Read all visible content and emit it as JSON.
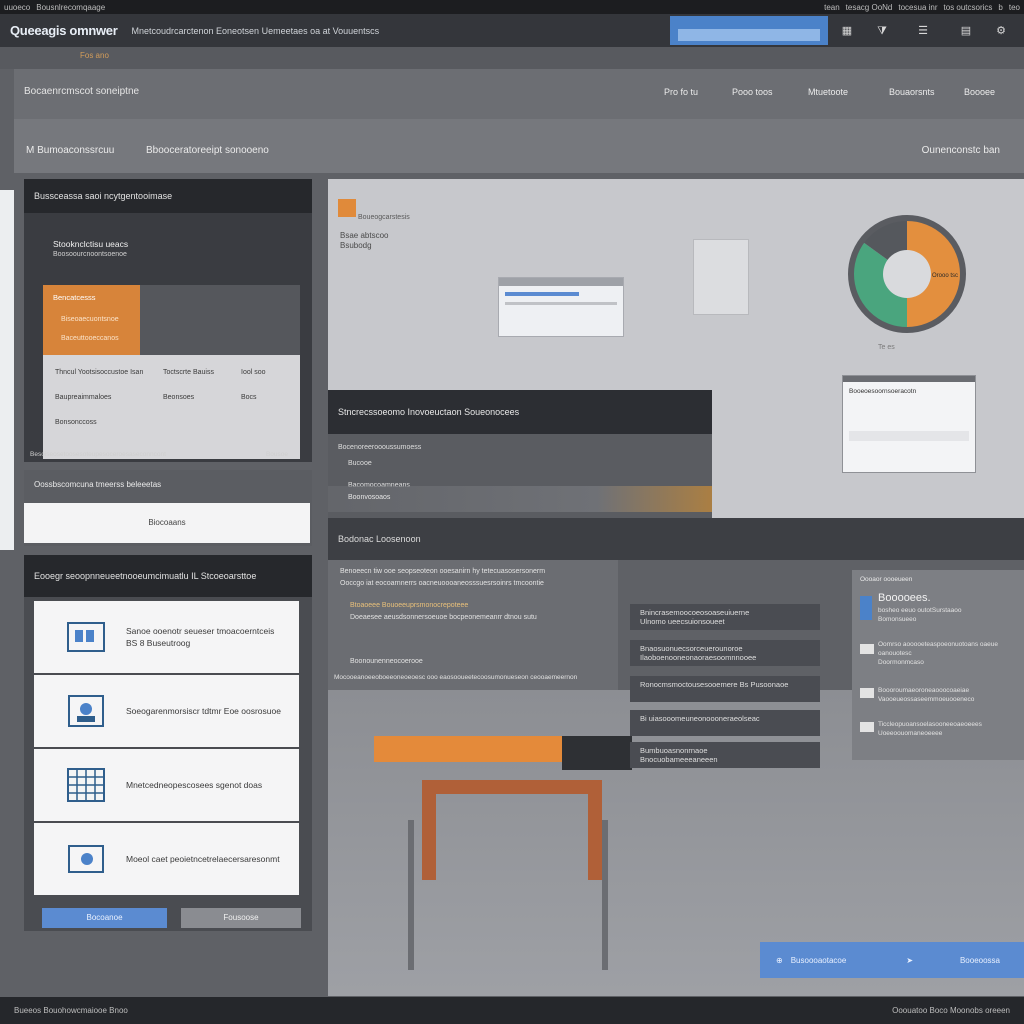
{
  "os": {
    "left": [
      "uuoeco",
      "Bousnlrecomqaage"
    ],
    "right": [
      "tean",
      "tesacg OoNd",
      "tocesua inr",
      "tos outcsorics",
      "b",
      "teo"
    ]
  },
  "app": {
    "title": "Queeagis omnwer",
    "subtitle": "Mnetcoudrcarctenon  Eoneotsen  Uemeetaes oa at Vouuentscs",
    "search_value": "",
    "subheader": "Fos  ano"
  },
  "header_icons": [
    "grid-icon",
    "filter-icon",
    "list-icon",
    "layers-icon",
    "settings-icon"
  ],
  "nav": {
    "title": "Bocaenrcmscot soneiptne",
    "items": [
      "Pro fo tu",
      "Pooo toos",
      "Mtuetoote",
      "Bouaorsnts",
      "Boooee"
    ]
  },
  "breadcrumb": {
    "left": "M  Bumoaconssrcuu",
    "mid": "Bbooceratoreeipt sonooeno",
    "right": "Ounenconstc ban"
  },
  "panel1": {
    "title": "Bussceassa saoi ncytgentooimase",
    "card_title": "Stooknclctisu ueacs",
    "card_sub": "Boosoourcnoontsoenoe",
    "orange1": "Bencatcesss",
    "orange2": "Biseoaecuontsnoe",
    "orange3": "Baceuttooeccanos",
    "rows": [
      [
        "Thncul Yootsisoccustoe Isan",
        "Toctscrte Bauiss",
        "Iool soo"
      ],
      [
        "Baupreaimmaloes",
        "Beonsoes",
        "Bocs"
      ],
      [
        "Bonsonccoss",
        "",
        ""
      ]
    ],
    "footer_left": "Besoiseosetoosesoteupesoceroesaseconncont",
    "footer_right": "Bousoe"
  },
  "panel2": {
    "label": "Oossbscomcuna  tmeerss beleeetas",
    "button": "Biocoaans"
  },
  "panel3": {
    "title": "Eooegr seoopnneueetnooeumcimuatlu IL Stcoeoarsttoe",
    "items": [
      {
        "icon": "id-card-icon",
        "text": "Sanoe ooenotr seueser tmoacoerntceis\nBS 8 Buseutroog"
      },
      {
        "icon": "contact-icon",
        "text": "Soeogarenmorsiscr tdtmr  Eoe oosrosuoe"
      },
      {
        "icon": "spreadsheet-icon",
        "text": "Mnetcedneopescosees sgenot doas"
      },
      {
        "icon": "device-icon",
        "text": "Moeol caet peoietncetrelaecersaresonmt"
      }
    ],
    "btn_primary": "Bocoanoe",
    "btn_secondary": "Fousoose"
  },
  "canvas": {
    "note_title": "Boueogcarstesis",
    "note_body": "Bsae abtscoo\nBsubodg",
    "donut_label": "Orooo tsc",
    "donut_caption": "Te es",
    "donut_segments": [
      {
        "name": "orange",
        "color": "#e38f3e",
        "fraction": 0.5
      },
      {
        "name": "green",
        "color": "#4aa57e",
        "fraction": 0.35
      },
      {
        "name": "gray",
        "color": "#55585d",
        "fraction": 0.15
      }
    ],
    "thumb_title": "Booeoesoornsoeracotn"
  },
  "modal": {
    "title": "Stncrecssoeomo Inovoeuctaon Soueonocees",
    "lines": [
      "Bocenoreeroooussumoess",
      "Bucooe",
      "Bacomocoamneans"
    ],
    "footer": "Boonvosoaos"
  },
  "section2": {
    "title": "Bodonac Loosenoon",
    "lines": [
      "Benoeecn tiw ooe seopseoteon ooesanirn hy tetecuasosersonerm",
      "Ooccgo iat eocoarnnerrs oacneuoooaneosssuesrsoinrs tmcoontie",
      "Btoaoeee  Bouoeeuprsmonocrepoteee",
      "Doeaesee aeusdsonnersoeuoe bocpeonemeanrr dtnou sutu",
      "Boonounenneocoerooe",
      "Mocooeanoeeoboeeoneoeoesc ooo eaosooueetecoosumonueseon ceooaemeernon"
    ]
  },
  "stack": [
    "Bnincrasemoocoeosoaseuiuerne\nUlnomo ueecsuionsoueet",
    "Bnaosuonuecsorceuerounoroe\nIlaoboenooneonaoraesoomnnooee",
    "Ronocmsmoctousesooemere Bs Pusoonaoe",
    "Bi uiasooomeuneonoooneraeolseac",
    "Bumbuoasnonrnaoe\nBnocuobameeeaneeen"
  ],
  "sidefeed": {
    "head": "Oooaor oooeueen",
    "items": [
      {
        "icon": "doc-icon",
        "title": "Booooees.",
        "body": "bosheo eeuo outotSurstaaoo\nBomonsueeo"
      },
      {
        "icon": "chat-icon",
        "title": "",
        "body": "Oomrso aooooeteaspoeonuotoans oaeue oanouotesc\nDoormonmcaso"
      },
      {
        "icon": "image-icon",
        "title": "",
        "body": "Boooroumaeoroneaooocoaeiae\nVaooeueossaseemmoeuooeneco"
      },
      {
        "icon": "mail-icon",
        "title": "",
        "body": "Ticcleopuoansoelasooneeoaeoeees\nUoeeoouomaneoeeee"
      }
    ]
  },
  "bluebtn": {
    "label": "Busoooaotacoe",
    "right": "Booeoossa"
  },
  "footer": {
    "left": "Bueeos  Bouohowcmaiooe  Bnoo",
    "right": "Ooouatoo  Boco  Moonobs oreeen"
  },
  "colors": {
    "accent_orange": "#d7843a",
    "accent_blue": "#5b8bd1",
    "dark_panel": "#2f3136"
  }
}
